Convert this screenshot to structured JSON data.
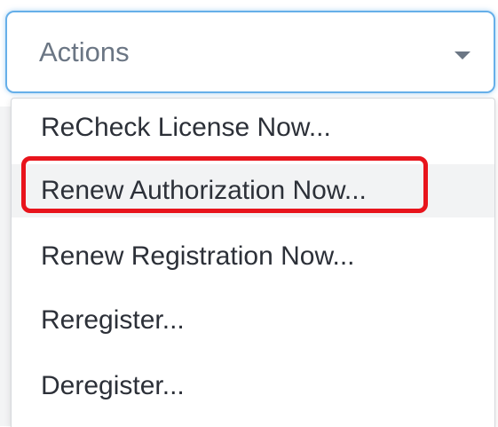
{
  "select": {
    "label": "Actions",
    "caret_icon": "caret-down-icon"
  },
  "menu": {
    "items": [
      {
        "label": "ReCheck License Now..."
      },
      {
        "label": "Renew Authorization Now..."
      },
      {
        "label": "Renew Registration Now..."
      },
      {
        "label": "Reregister..."
      },
      {
        "label": "Deregister..."
      }
    ],
    "hovered_index": 1
  },
  "colors": {
    "focus_border": "#66afe9",
    "highlight": "#e8141c",
    "text": "#2c3038",
    "placeholder": "#6b7684"
  }
}
